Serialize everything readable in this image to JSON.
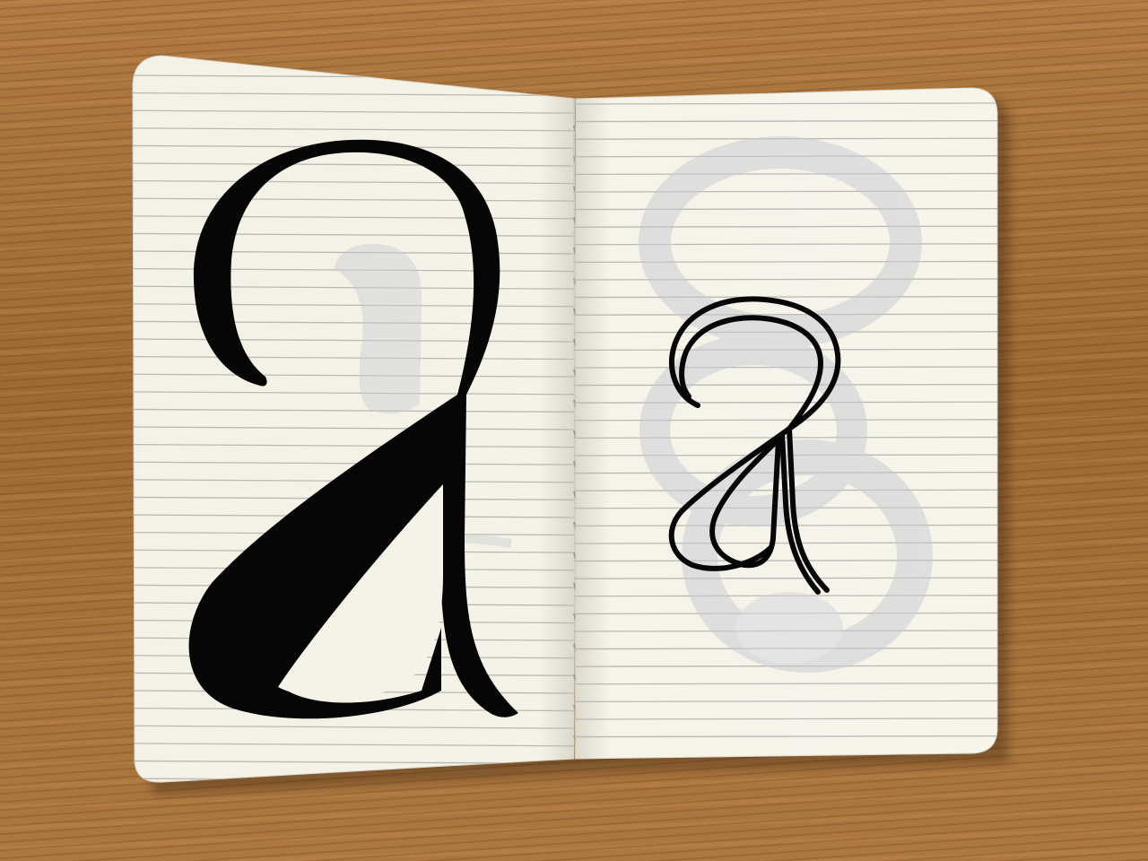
{
  "scene": {
    "description_free": true,
    "colors": {
      "desk": "#a8743e",
      "paper": "#f6f3e8",
      "rule_line": "#b9b9b4",
      "ink": "#060606",
      "show_through": "#cfd2d8"
    },
    "left_page": {
      "letter": "a",
      "style": "filled calligraphic"
    },
    "right_page": {
      "letter": "a",
      "style": "outlined monoline"
    }
  }
}
